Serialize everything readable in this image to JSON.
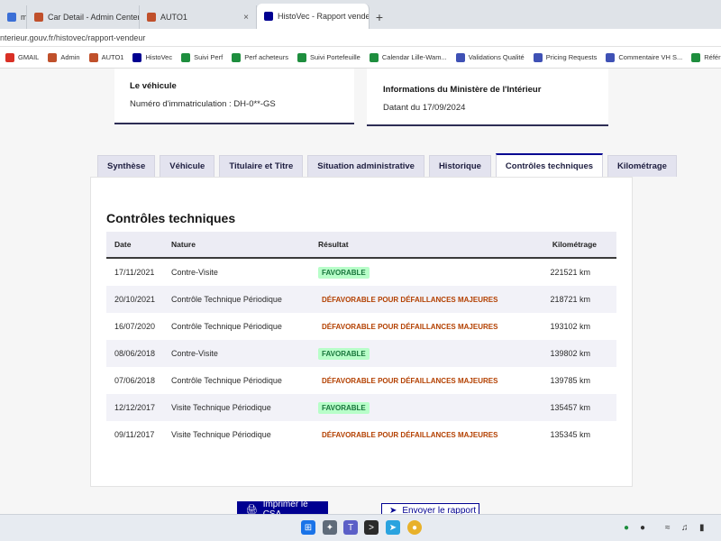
{
  "browser": {
    "tabs": [
      {
        "label": "m",
        "active": false,
        "icon": "page-icon",
        "color": "#3b6fd6"
      },
      {
        "label": "Car Detail - Admin Center",
        "active": false,
        "icon": "auto1-icon",
        "color": "#c0502b"
      },
      {
        "label": "AUTO1",
        "active": false,
        "icon": "auto1-icon",
        "color": "#c0502b"
      },
      {
        "label": "HistoVec - Rapport vendeur",
        "active": true,
        "icon": "french-flag-icon",
        "color": "#000091"
      }
    ],
    "url": "nterieur.gouv.fr/histovec/rapport-vendeur",
    "bookmarks": [
      {
        "label": "GMAIL",
        "icon": "gmail-icon",
        "color": "#d93025"
      },
      {
        "label": "Admin",
        "icon": "auto1-icon",
        "color": "#c0502b"
      },
      {
        "label": "AUTO1",
        "icon": "auto1-icon",
        "color": "#c0502b"
      },
      {
        "label": "HistoVec",
        "icon": "french-flag-icon",
        "color": "#000091"
      },
      {
        "label": "Suivi Perf",
        "icon": "sheets-icon",
        "color": "#1e8e3e"
      },
      {
        "label": "Perf acheteurs",
        "icon": "sheets-icon",
        "color": "#1e8e3e"
      },
      {
        "label": "Suivi Portefeuille",
        "icon": "sheets-icon",
        "color": "#1e8e3e"
      },
      {
        "label": "Calendar Lille-Wam...",
        "icon": "sheets-icon",
        "color": "#1e8e3e"
      },
      {
        "label": "Validations Qualité",
        "icon": "form-icon",
        "color": "#3f51b5"
      },
      {
        "label": "Pricing Requests",
        "icon": "form-icon",
        "color": "#3f51b5"
      },
      {
        "label": "Commentaire VH S...",
        "icon": "form-icon",
        "color": "#3f51b5"
      },
      {
        "label": "Référentiel_VIN",
        "icon": "sheets-icon",
        "color": "#1e8e3e"
      }
    ]
  },
  "vehicle_card": {
    "title": "Le véhicule",
    "line": "Numéro d'immatriculation : DH-0**-GS"
  },
  "ministry_card": {
    "title": "Informations du Ministère de l'Intérieur",
    "line": "Datant du 17/09/2024"
  },
  "tabs": [
    {
      "label": "Synthèse",
      "active": false
    },
    {
      "label": "Véhicule",
      "active": false
    },
    {
      "label": "Titulaire et Titre",
      "active": false
    },
    {
      "label": "Situation administrative",
      "active": false
    },
    {
      "label": "Historique",
      "active": false
    },
    {
      "label": "Contrôles techniques",
      "active": true
    },
    {
      "label": "Kilométrage",
      "active": false
    }
  ],
  "section_title": "Contrôles techniques",
  "table": {
    "headers": {
      "date": "Date",
      "nature": "Nature",
      "result": "Résultat",
      "km": "Kilométrage"
    },
    "rows": [
      {
        "date": "17/11/2021",
        "nature": "Contre-Visite",
        "result": "FAVORABLE",
        "status": "ok",
        "km": "221521 km"
      },
      {
        "date": "20/10/2021",
        "nature": "Contrôle Technique Périodique",
        "result": "DÉFAVORABLE POUR DÉFAILLANCES MAJEURES",
        "status": "ko",
        "km": "218721 km"
      },
      {
        "date": "16/07/2020",
        "nature": "Contrôle Technique Périodique",
        "result": "DÉFAVORABLE POUR DÉFAILLANCES MAJEURES",
        "status": "ko",
        "km": "193102 km"
      },
      {
        "date": "08/06/2018",
        "nature": "Contre-Visite",
        "result": "FAVORABLE",
        "status": "ok",
        "km": "139802 km"
      },
      {
        "date": "07/06/2018",
        "nature": "Contrôle Technique Périodique",
        "result": "DÉFAVORABLE POUR DÉFAILLANCES MAJEURES",
        "status": "ko",
        "km": "139785 km"
      },
      {
        "date": "12/12/2017",
        "nature": "Visite Technique Périodique",
        "result": "FAVORABLE",
        "status": "ok",
        "km": "135457 km"
      },
      {
        "date": "09/11/2017",
        "nature": "Visite Technique Périodique",
        "result": "DÉFAVORABLE POUR DÉFAILLANCES MAJEURES",
        "status": "ko",
        "km": "135345 km"
      }
    ]
  },
  "buttons": {
    "print": "Imprimer le CSA",
    "send": "Envoyer le rapport"
  },
  "colors": {
    "primary": "#000091",
    "success_bg": "#b8fec9",
    "success_text": "#18753c",
    "error_text": "#b34000"
  },
  "taskbar": {
    "apps": [
      "windows-start-icon",
      "snip-icon",
      "teams-icon",
      "terminal-icon",
      "telegram-icon",
      "chrome-icon"
    ]
  }
}
